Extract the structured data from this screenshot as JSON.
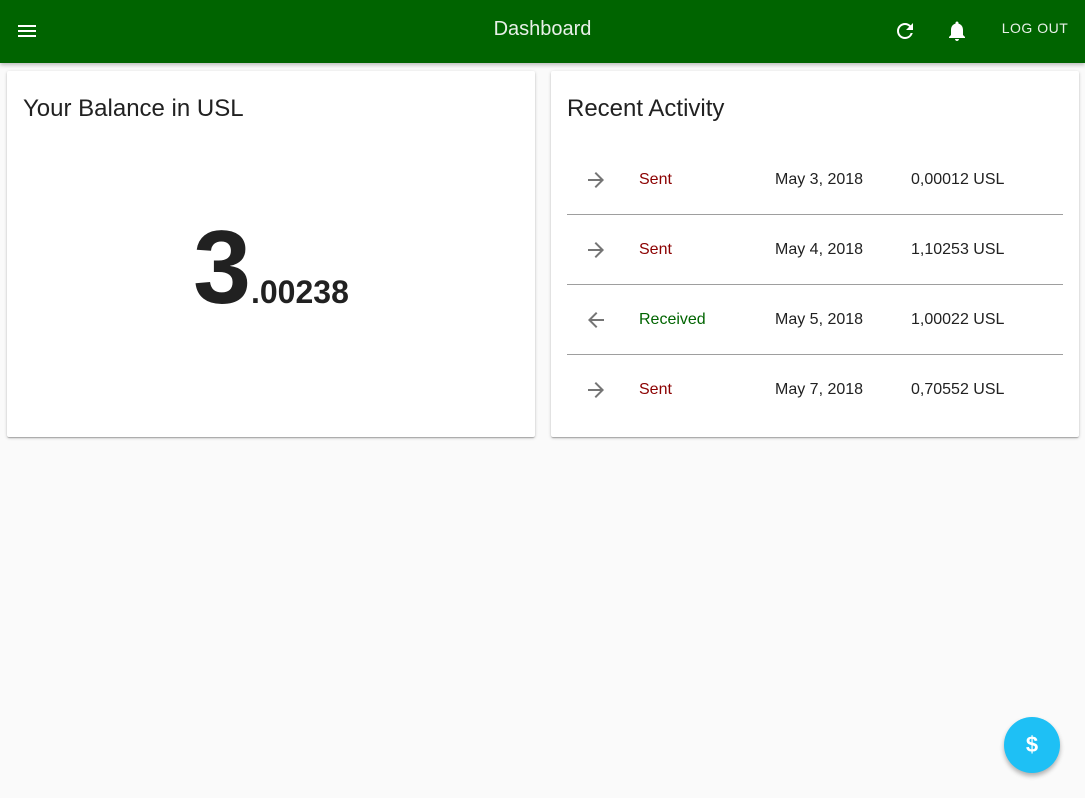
{
  "appbar": {
    "title": "Dashboard",
    "menu_icon": "menu-icon",
    "refresh_icon": "refresh-icon",
    "bell_icon": "bell-icon",
    "logout_label": "LOG OUT",
    "background_color": "#006400"
  },
  "balance": {
    "title": "Your Balance in USL",
    "integer_part": "3",
    "decimal_part": ".00238"
  },
  "activity": {
    "title": "Recent Activity",
    "items": [
      {
        "direction_icon": "arrow-right-icon",
        "type": "Sent",
        "date": "May 3, 2018",
        "amount": "0,00012 USL",
        "type_color": "#8b0000"
      },
      {
        "direction_icon": "arrow-right-icon",
        "type": "Sent",
        "date": "May 4, 2018",
        "amount": "1,10253 USL",
        "type_color": "#8b0000"
      },
      {
        "direction_icon": "arrow-left-icon",
        "type": "Received",
        "date": "May 5, 2018",
        "amount": "1,00022 USL",
        "type_color": "#006400"
      },
      {
        "direction_icon": "arrow-right-icon",
        "type": "Sent",
        "date": "May 7, 2018",
        "amount": "0,70552 USL",
        "type_color": "#8b0000"
      }
    ]
  },
  "fab": {
    "label": "$",
    "icon": "dollar-icon",
    "color": "#1ec0f5"
  }
}
